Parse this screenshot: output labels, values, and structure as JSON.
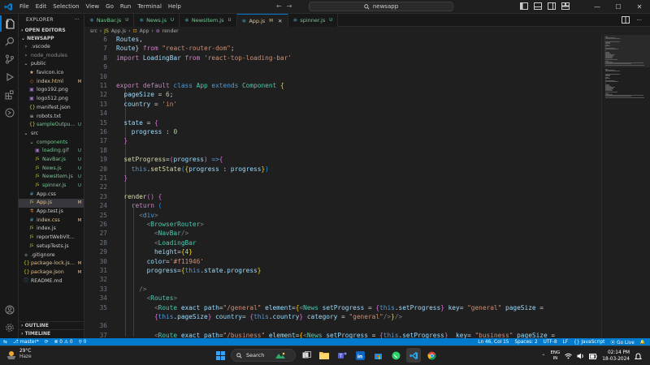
{
  "titlebar": {
    "menu": [
      "File",
      "Edit",
      "Selection",
      "View",
      "Go",
      "Run",
      "Terminal",
      "Help"
    ],
    "search_text": "newsapp",
    "nav_back": "←",
    "nav_forward": "→",
    "win_min": "—",
    "win_max": "☐",
    "win_close": "✕"
  },
  "sidebar": {
    "explorer_label": "EXPLORER",
    "more": "···",
    "open_editors": "OPEN EDITORS",
    "project": "NEWSAPP",
    "items": [
      {
        "name": ".vscode",
        "icon": "›",
        "icon_color": "#cccccc",
        "indent": 6,
        "badge": "",
        "badge_color": "#73c991",
        "color": "#cccccc"
      },
      {
        "name": "node_modules",
        "icon": "›",
        "icon_color": "#cccccc",
        "indent": 6,
        "badge": "",
        "badge_color": "#cccccc",
        "color": "#8c8c8c"
      },
      {
        "name": "public",
        "icon": "⌄",
        "icon_color": "#cccccc",
        "indent": 6,
        "badge": "",
        "badge_color": "#e2c08d",
        "color": "#cccccc"
      },
      {
        "name": "favicon.ico",
        "icon": "★",
        "icon_color": "#e2c08d",
        "indent": 13,
        "badge": "",
        "badge_color": "#cccccc",
        "color": "#cccccc"
      },
      {
        "name": "index.html",
        "icon": "◇",
        "icon_color": "#e37933",
        "indent": 13,
        "badge": "M",
        "badge_color": "#e2c08d",
        "color": "#e2c08d"
      },
      {
        "name": "logo192.png",
        "icon": "▣",
        "icon_color": "#a074c4",
        "indent": 13,
        "badge": "",
        "badge_color": "#cccccc",
        "color": "#cccccc"
      },
      {
        "name": "logo512.png",
        "icon": "▣",
        "icon_color": "#a074c4",
        "indent": 13,
        "badge": "",
        "badge_color": "#cccccc",
        "color": "#cccccc"
      },
      {
        "name": "manifest.json",
        "icon": "{}",
        "icon_color": "#cbcb41",
        "indent": 13,
        "badge": "",
        "badge_color": "#cccccc",
        "color": "#cccccc"
      },
      {
        "name": "robots.txt",
        "icon": "≡",
        "icon_color": "#cccccc",
        "indent": 13,
        "badge": "",
        "badge_color": "#cccccc",
        "color": "#cccccc"
      },
      {
        "name": "sampleOutput.j...",
        "icon": "{}",
        "icon_color": "#cbcb41",
        "indent": 13,
        "badge": "U",
        "badge_color": "#73c991",
        "color": "#73c991"
      },
      {
        "name": "src",
        "icon": "⌄",
        "icon_color": "#cccccc",
        "indent": 6,
        "badge": "",
        "badge_color": "#73c991",
        "color": "#cccccc"
      },
      {
        "name": "components",
        "icon": "⌄",
        "icon_color": "#cccccc",
        "indent": 13,
        "badge": "",
        "badge_color": "#73c991",
        "color": "#73c991"
      },
      {
        "name": "loading.gif",
        "icon": "▣",
        "icon_color": "#a074c4",
        "indent": 20,
        "badge": "U",
        "badge_color": "#73c991",
        "color": "#73c991"
      },
      {
        "name": "NavBar.js",
        "icon": "JS",
        "icon_color": "#cbcb41",
        "indent": 20,
        "badge": "U",
        "badge_color": "#73c991",
        "color": "#73c991"
      },
      {
        "name": "News.js",
        "icon": "JS",
        "icon_color": "#cbcb41",
        "indent": 20,
        "badge": "U",
        "badge_color": "#73c991",
        "color": "#73c991"
      },
      {
        "name": "NewsItem.js",
        "icon": "JS",
        "icon_color": "#cbcb41",
        "indent": 20,
        "badge": "U",
        "badge_color": "#73c991",
        "color": "#73c991"
      },
      {
        "name": "spinner.js",
        "icon": "JS",
        "icon_color": "#cbcb41",
        "indent": 20,
        "badge": "U",
        "badge_color": "#73c991",
        "color": "#73c991"
      },
      {
        "name": "App.css",
        "icon": "#",
        "icon_color": "#519aba",
        "indent": 13,
        "badge": "",
        "badge_color": "#cccccc",
        "color": "#cccccc"
      },
      {
        "name": "App.js",
        "icon": "JS",
        "icon_color": "#cbcb41",
        "indent": 13,
        "badge": "M",
        "badge_color": "#e2c08d",
        "color": "#e2c08d",
        "selected": true
      },
      {
        "name": "App.test.js",
        "icon": "⚗",
        "icon_color": "#e37933",
        "indent": 13,
        "badge": "",
        "badge_color": "#cccccc",
        "color": "#cccccc"
      },
      {
        "name": "index.css",
        "icon": "#",
        "icon_color": "#519aba",
        "indent": 13,
        "badge": "M",
        "badge_color": "#e2c08d",
        "color": "#e2c08d"
      },
      {
        "name": "index.js",
        "icon": "JS",
        "icon_color": "#cbcb41",
        "indent": 13,
        "badge": "",
        "badge_color": "#cccccc",
        "color": "#cccccc"
      },
      {
        "name": "reportWebVitals.js",
        "icon": "JS",
        "icon_color": "#cbcb41",
        "indent": 13,
        "badge": "",
        "badge_color": "#cccccc",
        "color": "#cccccc"
      },
      {
        "name": "setupTests.js",
        "icon": "JS",
        "icon_color": "#cbcb41",
        "indent": 13,
        "badge": "",
        "badge_color": "#cccccc",
        "color": "#cccccc"
      },
      {
        "name": ".gitignore",
        "icon": "◆",
        "icon_color": "#41535b",
        "indent": 6,
        "badge": "",
        "badge_color": "#cccccc",
        "color": "#cccccc"
      },
      {
        "name": "package-lock.json",
        "icon": "{}",
        "icon_color": "#cbcb41",
        "indent": 6,
        "badge": "M",
        "badge_color": "#e2c08d",
        "color": "#e2c08d"
      },
      {
        "name": "package.json",
        "icon": "{}",
        "icon_color": "#cbcb41",
        "indent": 6,
        "badge": "M",
        "badge_color": "#e2c08d",
        "color": "#e2c08d"
      },
      {
        "name": "README.md",
        "icon": "ⓘ",
        "icon_color": "#519aba",
        "indent": 6,
        "badge": "",
        "badge_color": "#cccccc",
        "color": "#cccccc"
      }
    ],
    "outline": "OUTLINE",
    "timeline": "TIMELINE"
  },
  "tabs": [
    {
      "label": "NavBar.js",
      "badge": "U",
      "active": false
    },
    {
      "label": "News.js",
      "badge": "U",
      "active": false
    },
    {
      "label": "NewsItem.js",
      "badge": "U",
      "active": false
    },
    {
      "label": "App.js",
      "badge": "M",
      "active": true
    },
    {
      "label": "spinner.js",
      "badge": "U",
      "active": false
    }
  ],
  "breadcrumb": {
    "seg1": "src",
    "seg2": "App.js",
    "seg3": "App",
    "seg4": "render"
  },
  "editor": {
    "lines": [
      {
        "n": "6",
        "code": "<span class='var'>Routes</span>,"
      },
      {
        "n": "7",
        "code": "<span class='var'>Route</span>} <span class='kw2'>from</span> <span class='str'>\"react-router-dom\"</span>;"
      },
      {
        "n": "8",
        "code": "<span class='kw2'>import</span> <span class='var'>LoadingBar</span> <span class='kw2'>from</span> <span class='str'>'react-top-loading-bar'</span>"
      },
      {
        "n": "9",
        "code": ""
      },
      {
        "n": "10",
        "code": ""
      },
      {
        "n": "11",
        "code": "<span class='kw2'>export</span> <span class='kw2'>default</span> <span class='kw'>class</span> <span class='cls'>App</span> <span class='kw'>extends</span> <span class='cls'>Component</span> <span class='br1'>{</span>"
      },
      {
        "n": "12",
        "code": "  <span class='var'>pageSize</span> = <span class='num'>6</span>;"
      },
      {
        "n": "13",
        "code": "  <span class='var'>country</span> = <span class='str'>'in'</span>"
      },
      {
        "n": "14",
        "code": ""
      },
      {
        "n": "15",
        "code": "  <span class='var'>state</span> = <span class='br2'>{</span>"
      },
      {
        "n": "16",
        "code": "    <span class='var'>progress</span> : <span class='num'>0</span>"
      },
      {
        "n": "17",
        "code": "  <span class='br2'>}</span>"
      },
      {
        "n": "18",
        "code": ""
      },
      {
        "n": "19",
        "code": "  <span class='fn'>setProgress</span>=<span class='br2'>(</span><span class='var'>progress</span><span class='br2'>)</span> <span class='kw'>=&gt;</span><span class='br2'>{</span>"
      },
      {
        "n": "20",
        "code": "    <span class='kw'>this</span>.<span class='fn'>setState</span><span class='br3'>(</span><span class='br1'>{</span><span class='var'>progress</span> : <span class='var'>progress</span><span class='br1'>}</span><span class='br3'>)</span>"
      },
      {
        "n": "21",
        "code": "  <span class='br2'>}</span>"
      },
      {
        "n": "22",
        "code": ""
      },
      {
        "n": "23",
        "code": "  <span class='fn'>render</span><span class='br2'>()</span> <span class='br2'>{</span>"
      },
      {
        "n": "24",
        "code": "    <span class='kw2'>return</span> <span class='br3'>(</span>"
      },
      {
        "n": "25",
        "code": "      <span class='tagbr'>&lt;</span><span class='kw'>div</span><span class='tagbr'>&gt;</span>"
      },
      {
        "n": "26",
        "code": "        <span class='tagbr'>&lt;</span><span class='tag'>BrowserRouter</span><span class='tagbr'>&gt;</span>"
      },
      {
        "n": "27",
        "code": "          <span class='tagbr'>&lt;</span><span class='tag'>NavBar</span><span class='tagbr'>/&gt;</span>"
      },
      {
        "n": "28",
        "code": "          <span class='tagbr'>&lt;</span><span class='tag'>LoadingBar</span>"
      },
      {
        "n": "29",
        "code": "          <span class='attr'>height</span>=<span class='br1'>{</span><span class='num'>4</span><span class='br1'>}</span>"
      },
      {
        "n": "30",
        "code": "        <span class='attr'>color</span>=<span class='str'>'#f11946'</span>"
      },
      {
        "n": "31",
        "code": "        <span class='attr'>progress</span>=<span class='br1'>{</span><span class='kw'>this</span>.<span class='var'>state</span>.<span class='var'>progress</span><span class='br1'>}</span>"
      },
      {
        "n": "32",
        "code": ""
      },
      {
        "n": "33",
        "code": "      <span class='tagbr'>/&gt;</span>"
      },
      {
        "n": "34",
        "code": "        <span class='tagbr'>&lt;</span><span class='tag'>Routes</span><span class='tagbr'>&gt;</span>"
      },
      {
        "n": "35",
        "code": "          <span class='tagbr'>&lt;</span><span class='tag'>Route</span> <span class='attr'>exact</span> <span class='attr'>path</span>=<span class='str'>\"/general\"</span> <span class='attr'>element</span>=<span class='br1'>{</span><span class='tagbr'>&lt;</span><span class='tag'>News</span> <span class='attr'>setProgress</span> = <span class='br2'>{</span><span class='kw'>this</span>.<span class='var'>setProgress</span><span class='br2'>}</span> <span class='attr'>key</span>= <span class='str'>\"general\"</span> <span class='attr'>pageSize</span> ="
      },
      {
        "n": "",
        "code": "          <span class='br2'>{</span><span class='kw'>this</span>.<span class='var'>pageSize</span><span class='br2'>}</span> <span class='attr'>country</span>= <span class='br2'>{</span><span class='kw'>this</span>.<span class='var'>country</span><span class='br2'>}</span> <span class='attr'>category</span> = <span class='str'>\"general\"</span><span class='tagbr'>/&gt;</span><span class='br1'>}</span><span class='tagbr'>/&gt;</span>"
      },
      {
        "n": "36",
        "code": ""
      },
      {
        "n": "37",
        "code": "          <span class='tagbr'>&lt;</span><span class='tag'>Route</span> <span class='attr'>exact</span> <span class='attr'>path</span>=<span class='str'>\"/business\"</span> <span class='attr'>element</span>=<span class='br1'>{</span><span class='tagbr'>&lt;</span><span class='tag'>News</span> <span class='attr'>setProgress</span> = <span class='br2'>{</span><span class='kw'>this</span>.<span class='var'>setProgress</span><span class='br2'>}</span>  <span class='attr'>key</span>= <span class='str'>\"business\"</span> <span class='attr'>pageSize</span> ="
      }
    ]
  },
  "statusbar": {
    "remote": "⇆",
    "branch": "master*",
    "sync": "⟳",
    "problems": "⊗ 0 ⚠ 0",
    "ports": "⚲ 0",
    "position": "Ln 46, Col 15",
    "spaces": "Spaces: 2",
    "encoding": "UTF-8",
    "eol": "LF",
    "language": "{} JavaScript",
    "golive": "Go Live",
    "bell": "🔔"
  },
  "taskbar": {
    "temp": "29°C",
    "condition": "Haze",
    "search_label": "Search",
    "lang1": "ENG",
    "lang2": "IN",
    "time": "02:14 PM",
    "date": "18-03-2024"
  },
  "colors": {
    "accent": "#0078d4",
    "statusbar": "#007acc"
  }
}
